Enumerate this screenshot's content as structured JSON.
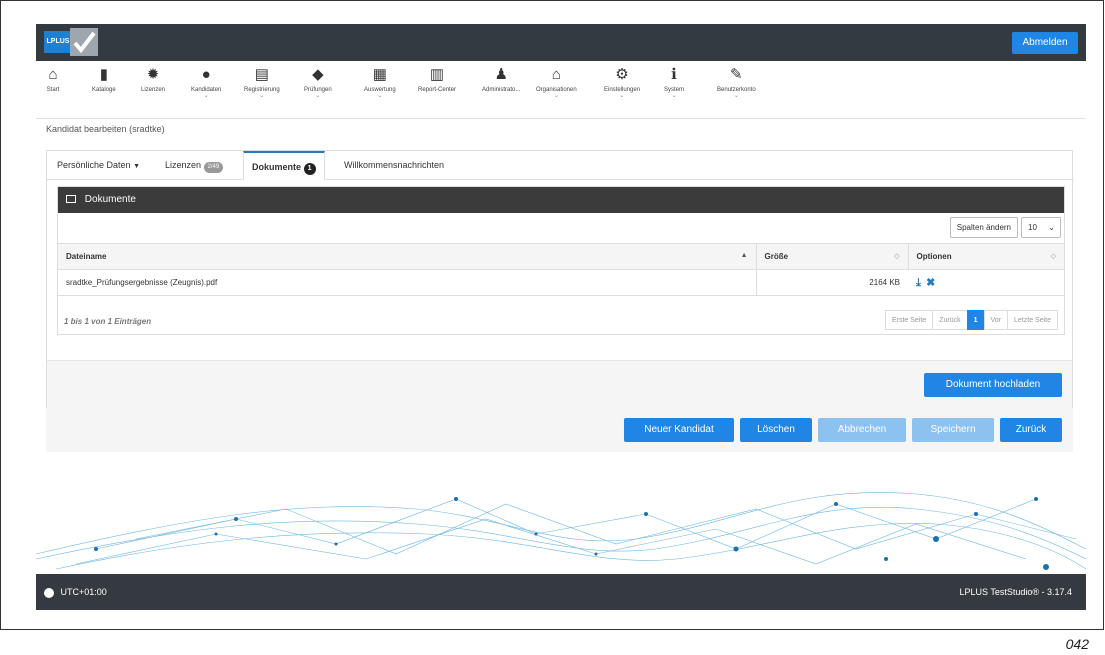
{
  "topbar": {
    "logo_text": "LPLUS",
    "logout_label": "Abmelden"
  },
  "nav": [
    {
      "label": "Start",
      "icon": "home-icon",
      "glyph": "⌂",
      "dropdown": false
    },
    {
      "label": "Kataloge",
      "icon": "book-icon",
      "glyph": "▮",
      "dropdown": false
    },
    {
      "label": "Lizenzen",
      "icon": "certificate-icon",
      "glyph": "✹",
      "dropdown": false
    },
    {
      "label": "Kandidaten",
      "icon": "user-icon",
      "glyph": "●",
      "dropdown": true
    },
    {
      "label": "Registrierung",
      "icon": "id-card-icon",
      "glyph": "▤",
      "dropdown": true
    },
    {
      "label": "Prüfungen",
      "icon": "graduation-cap-icon",
      "glyph": "◆",
      "dropdown": true
    },
    {
      "label": "Auswertung",
      "icon": "table-icon",
      "glyph": "▦",
      "dropdown": true
    },
    {
      "label": "Report-Center",
      "icon": "bar-chart-icon",
      "glyph": "▥",
      "dropdown": false
    },
    {
      "label": "Administrato...",
      "icon": "admin-users-icon",
      "glyph": "♟",
      "dropdown": false
    },
    {
      "label": "Organisationen",
      "icon": "institution-icon",
      "glyph": "⌂",
      "dropdown": true
    },
    {
      "label": "Einstellungen",
      "icon": "cogs-icon",
      "glyph": "⚙",
      "dropdown": true
    },
    {
      "label": "System",
      "icon": "info-icon",
      "glyph": "ℹ",
      "dropdown": true
    },
    {
      "label": "Benutzerkonto",
      "icon": "wrench-icon",
      "glyph": "✎",
      "dropdown": true
    }
  ],
  "breadcrumb": "Kandidat bearbeiten (sradtke)",
  "tabs": {
    "personal": "Persönliche Daten",
    "licenses": "Lizenzen",
    "licenses_badge": "2/49",
    "documents": "Dokumente",
    "documents_badge": "1",
    "welcome": "Willkommensnachrichten"
  },
  "documents_panel": {
    "title": "Dokumente",
    "change_columns": "Spalten ändern",
    "page_size": "10",
    "columns": [
      "Dateiname",
      "Größe",
      "Optionen"
    ],
    "rows": [
      {
        "filename": "sradtke_Prüfungsergebnisse (Zeugnis).pdf",
        "size": "2164 KB"
      }
    ],
    "info": "1 bis 1 von 1 Einträgen",
    "pager": {
      "first": "Erste Seite",
      "prev": "Zurück",
      "current": "1",
      "next": "Vor",
      "last": "Letzte Seite"
    },
    "upload_label": "Dokument hochladen"
  },
  "actions": {
    "new_candidate": "Neuer Kandidat",
    "delete": "Löschen",
    "cancel": "Abbrechen",
    "save": "Speichern",
    "back": "Zurück"
  },
  "footer": {
    "timezone": "UTC+01:00",
    "version": "LPLUS TestStudio® - 3.17.4"
  },
  "page_number": "042",
  "colors": {
    "accent": "#1f86e6",
    "topbar": "#333a40",
    "footer": "#343a3f"
  }
}
